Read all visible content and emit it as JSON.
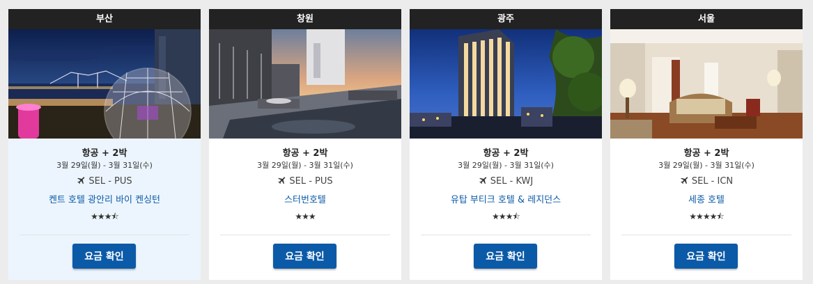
{
  "cards": [
    {
      "city": "부산",
      "package": "항공 + 2박",
      "dates": "3월 29일(월) - 3월 31일(수)",
      "route": "SEL - PUS",
      "hotel": "켄트 호텔 광안리 바이 켄싱턴",
      "stars": "★★★⯪",
      "rating": 3.5,
      "button": "요금 확인",
      "photo_icon": "glass-dome-night-city-photo"
    },
    {
      "city": "창원",
      "package": "항공 + 2박",
      "dates": "3월 29일(월) - 3월 31일(수)",
      "route": "SEL - PUS",
      "hotel": "스터번호텔",
      "stars": "★★★",
      "rating": 3,
      "button": "요금 확인",
      "photo_icon": "rooftop-pool-sunset-photo"
    },
    {
      "city": "광주",
      "package": "항공 + 2박",
      "dates": "3월 29일(월) - 3월 31일(수)",
      "route": "SEL - KWJ",
      "hotel": "유탑 부티크 호텔 & 레지던스",
      "stars": "★★★⯪",
      "rating": 3.5,
      "button": "요금 확인",
      "photo_icon": "tower-hotel-night-photo"
    },
    {
      "city": "서울",
      "package": "항공 + 2박",
      "dates": "3월 29일(월) - 3월 31일(수)",
      "route": "SEL - ICN",
      "hotel": "세종 호텔",
      "stars": "★★★★⯪",
      "rating": 4.5,
      "button": "요금 확인",
      "photo_icon": "hotel-suite-interior-photo"
    }
  ],
  "colors": {
    "header_bg": "#222222",
    "link": "#0b5aa8",
    "button_bg": "#0b5aa8",
    "highlight_bg": "#ecf5fd",
    "page_bg": "#ececec"
  }
}
